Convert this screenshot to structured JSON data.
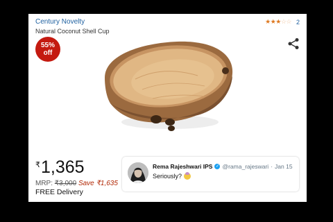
{
  "product": {
    "brand": "Century Novelty",
    "title": "Natural Coconut Shell Cup",
    "rating_count": "2",
    "rating_stars": 3,
    "discount_percent": "55%",
    "discount_word": "off",
    "currency_symbol": "₹",
    "price": "1,365",
    "mrp_label": "MRP:",
    "mrp_value": "₹3,000",
    "save_text": "Save ₹1,635",
    "delivery": "FREE Delivery"
  },
  "tweet": {
    "name": "Rema Rajeshwari IPS",
    "handle": "@rama_rajeswari",
    "separator": "·",
    "date": "Jan 15",
    "text": "Seriously?"
  },
  "colors": {
    "link": "#2162a1",
    "badge": "#c41a10",
    "save": "#b12704",
    "star": "#de7921",
    "verified": "#1da1f2"
  },
  "icons": [
    "star-icon",
    "share-icon",
    "verified-badge-icon",
    "woman-gesturing-emoji-icon"
  ]
}
